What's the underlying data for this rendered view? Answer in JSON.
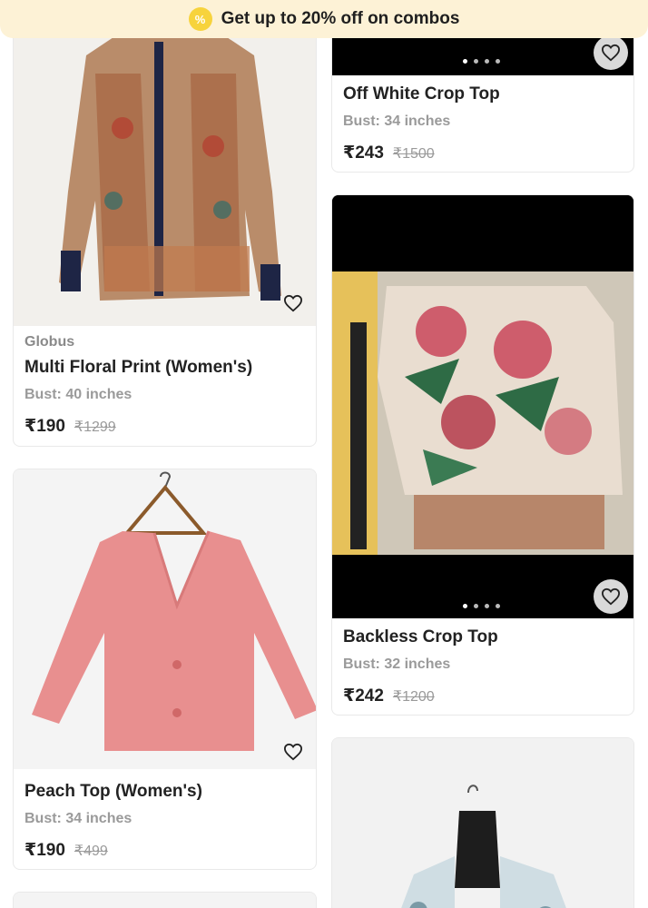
{
  "banner": {
    "badge_icon": "percent-badge-icon",
    "text": "Get up to 20% off on combos"
  },
  "products": [
    {
      "brand": "Globus",
      "title": "Multi Floral Print  (Women's)",
      "size": "Bust: 40 inches",
      "price": "₹190",
      "mrp": "₹1299"
    },
    {
      "title": "Off White Crop Top",
      "size": "Bust: 34 inches",
      "price": "₹243",
      "mrp": "₹1500"
    },
    {
      "title": "Backless Crop Top",
      "size": "Bust: 32 inches",
      "price": "₹242",
      "mrp": "₹1200"
    },
    {
      "title": "Peach Top (Women's)",
      "size": "Bust: 34 inches",
      "price": "₹190",
      "mrp": "₹499"
    }
  ],
  "colors": {
    "banner_bg": "#fdf2d6",
    "badge": "#f7d33c",
    "peach": "#e88f8f",
    "black_image_bg": "#000000"
  }
}
